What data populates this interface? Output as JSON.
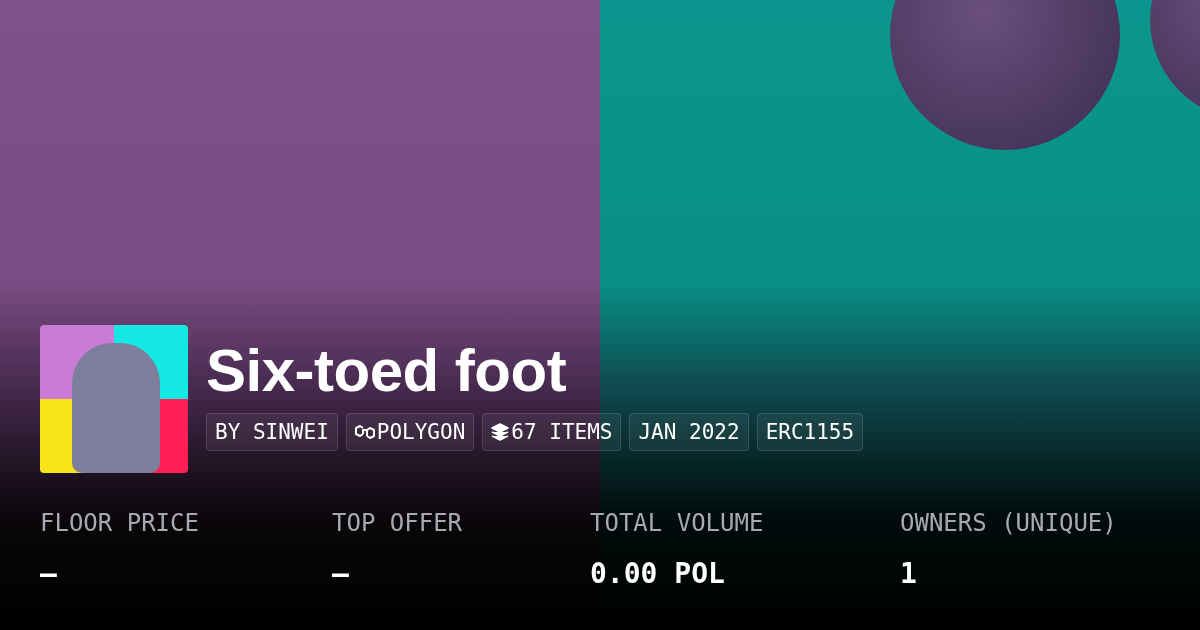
{
  "collection": {
    "name": "Six-toed foot"
  },
  "tags": [
    {
      "kind": "text",
      "label": "BY SINWEI"
    },
    {
      "kind": "chain",
      "label": "POLYGON"
    },
    {
      "kind": "items",
      "label": "67 ITEMS"
    },
    {
      "kind": "text",
      "label": "JAN 2022"
    },
    {
      "kind": "text",
      "label": "ERC1155"
    }
  ],
  "stats": [
    {
      "label": "FLOOR PRICE",
      "value": "–"
    },
    {
      "label": "TOP OFFER",
      "value": "–"
    },
    {
      "label": "TOTAL VOLUME",
      "value": "0.00 POL"
    },
    {
      "label": "OWNERS (UNIQUE)",
      "value": "1"
    }
  ]
}
